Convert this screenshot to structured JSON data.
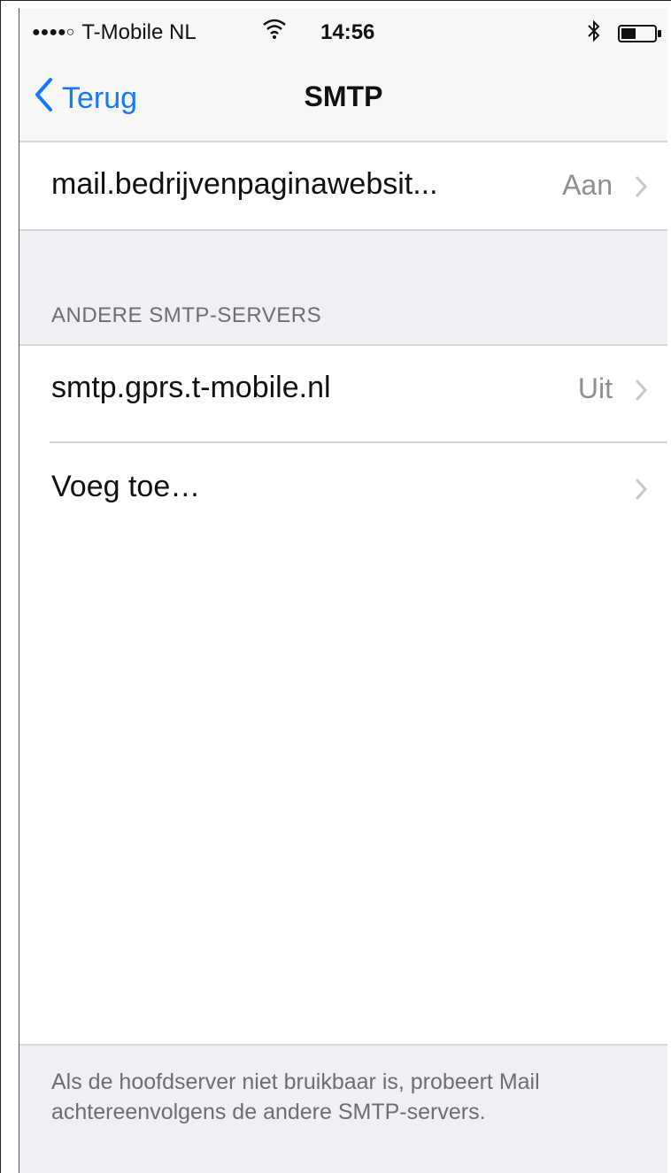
{
  "status_bar": {
    "carrier": "T-Mobile NL",
    "time": "14:56",
    "icons": [
      "signal-dots-icon",
      "wifi-icon",
      "bluetooth-icon",
      "battery-icon"
    ]
  },
  "nav": {
    "back_label": "Terug",
    "title": "SMTP"
  },
  "primary_server": {
    "label": "mail.bedrijvenpaginawebsit...",
    "value": "Aan"
  },
  "other_servers": {
    "header": "ANDERE SMTP-SERVERS",
    "items": [
      {
        "label": "smtp.gprs.t-mobile.nl",
        "value": "Uit"
      },
      {
        "label": "Voeg toe…",
        "value": ""
      }
    ]
  },
  "footer": {
    "text": "Als de hoofdserver niet bruikbaar is, probeert Mail achtereenvolgens de andere SMTP-servers."
  },
  "colors": {
    "accent": "#1479fb",
    "secondary_text": "#8e8e93",
    "group_bg": "#efeff4"
  }
}
